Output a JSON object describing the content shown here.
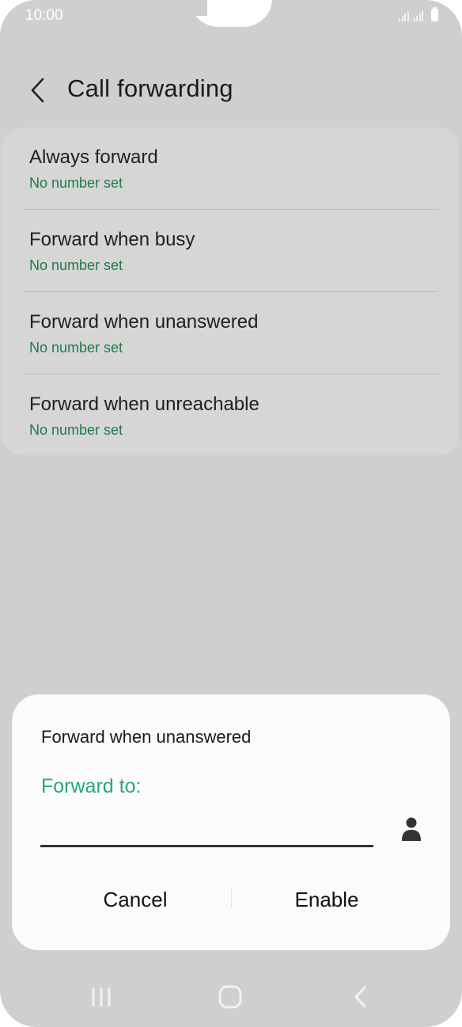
{
  "status_bar": {
    "time": "10:00"
  },
  "header": {
    "title": "Call forwarding",
    "back_icon": "chevron-left-icon"
  },
  "options": [
    {
      "title": "Always forward",
      "subtitle": "No number set"
    },
    {
      "title": "Forward when busy",
      "subtitle": "No number set"
    },
    {
      "title": "Forward when unanswered",
      "subtitle": "No number set"
    },
    {
      "title": "Forward when unreachable",
      "subtitle": "No number set"
    }
  ],
  "dialog": {
    "title": "Forward when unanswered",
    "field_label": "Forward to:",
    "field_value": "",
    "contact_icon": "person-icon",
    "cancel_label": "Cancel",
    "enable_label": "Enable"
  },
  "colors": {
    "accent_green": "#28a779",
    "subtitle_green": "#1f7a4a",
    "scrim_background": "#cfcfcf"
  },
  "nav_bar": {
    "recent_icon": "recent-apps-icon",
    "home_icon": "home-icon",
    "back_icon": "back-icon"
  }
}
